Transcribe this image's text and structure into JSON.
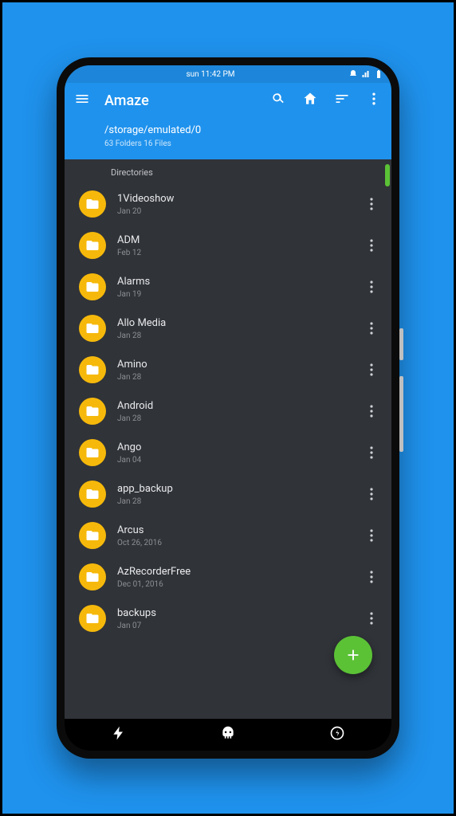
{
  "statusbar": {
    "time": "sun 11:42 PM"
  },
  "appbar": {
    "title": "Amaze",
    "path": "/storage/emulated/0",
    "stats": "63 Folders 16 Files"
  },
  "section_label": "Directories",
  "folders": [
    {
      "name": "1Videoshow",
      "date": "Jan 20"
    },
    {
      "name": "ADM",
      "date": "Feb 12"
    },
    {
      "name": "Alarms",
      "date": "Jan 19"
    },
    {
      "name": "Allo Media",
      "date": "Jan 28"
    },
    {
      "name": "Amino",
      "date": "Jan 28"
    },
    {
      "name": "Android",
      "date": "Jan 28"
    },
    {
      "name": "Ango",
      "date": "Jan 04"
    },
    {
      "name": "app_backup",
      "date": "Jan 28"
    },
    {
      "name": "Arcus",
      "date": "Oct 26, 2016"
    },
    {
      "name": "AzRecorderFree",
      "date": "Dec 01, 2016"
    },
    {
      "name": "backups",
      "date": "Jan 07"
    }
  ]
}
